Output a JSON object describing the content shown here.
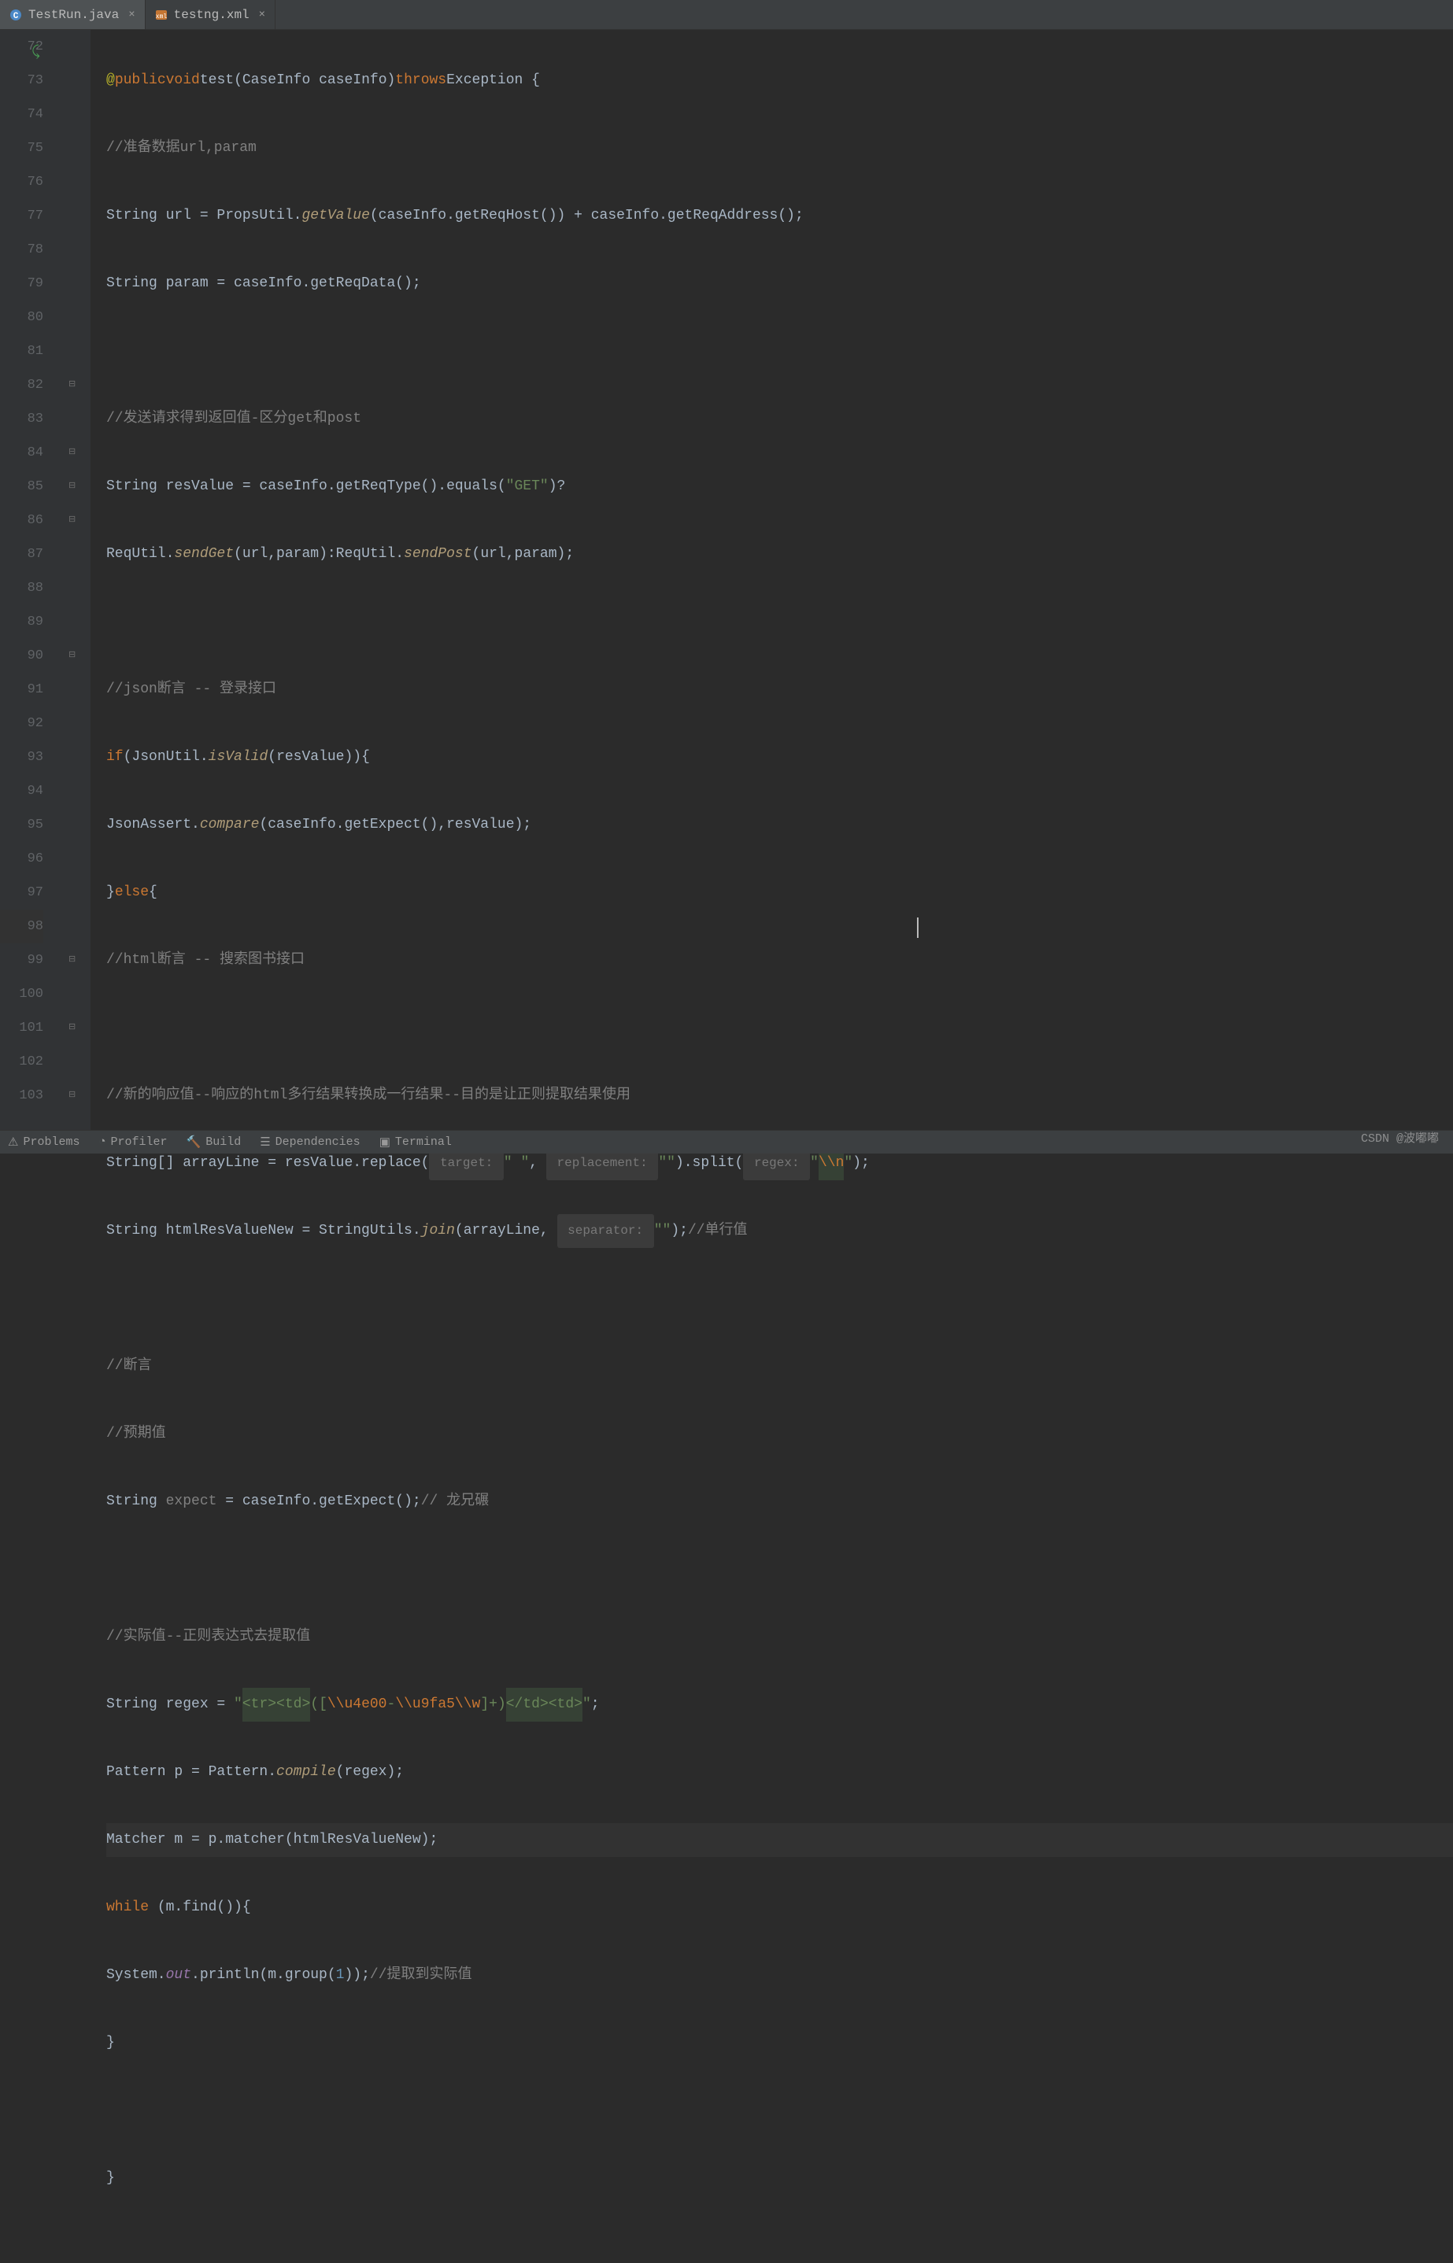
{
  "tabs": [
    {
      "label": "TestRun.java",
      "icon": "java-class-icon",
      "active": true
    },
    {
      "label": "testng.xml",
      "icon": "xml-icon",
      "active": false
    }
  ],
  "gutter": {
    "start": 72,
    "end": 103,
    "highlighted": 98
  },
  "code": {
    "l72_annotation": "@",
    "l72": {
      "kw1": "public",
      "kw2": "void",
      "name": "test",
      "p1": "(CaseInfo caseInfo)",
      "kw3": "throws",
      "ex": "Exception {"
    },
    "l73": "//准备数据url,param",
    "l74": {
      "t": "String url = PropsUtil.",
      "m": "getValue",
      "r": "(caseInfo.getReqHost()) + caseInfo.getReqAddress();"
    },
    "l75": "String param = caseInfo.getReqData();",
    "l77": "//发送请求得到返回值-区分get和post",
    "l78": {
      "a": "String resValue = caseInfo.getReqType().equals(",
      "s": "\"GET\"",
      "b": ")?"
    },
    "l79": {
      "a": "ReqUtil.",
      "m1": "sendGet",
      "b": "(url,param):ReqUtil.",
      "m2": "sendPost",
      "c": "(url,param);"
    },
    "l81": "//json断言 -- 登录接口",
    "l82": {
      "kw": "if",
      "a": "(JsonUtil.",
      "m": "isValid",
      "b": "(resValue)){"
    },
    "l83": {
      "a": "JsonAssert.",
      "m": "compare",
      "b": "(caseInfo.getExpect(),resValue);"
    },
    "l84": {
      "a": "}",
      "kw": "else",
      "b": "{"
    },
    "l85": "//html断言 -- 搜索图书接口",
    "l87": "//新的响应值--响应的html多行结果转换成一行结果--目的是让正则提取结果使用",
    "l88": {
      "a": "String[] arrayLine = resValue.replace(",
      "h1": " target: ",
      "s1": "\" \"",
      "c": ", ",
      "h2": " replacement: ",
      "s2": "\"\"",
      "d": ").split(",
      "h3": " regex: ",
      "s3a": "\"",
      "esc": "\\\\n",
      "s3b": "\"",
      "e": ");"
    },
    "l89": {
      "a": "String htmlResValueNew = StringUtils.",
      "m": "join",
      "b": "(arrayLine, ",
      "h": " separator: ",
      "s": "\"\"",
      "c": ");",
      "cm": "//单行值"
    },
    "l91": "//断言",
    "l92": "//预期值",
    "l93": {
      "a": "String ",
      "v": "expect",
      "b": " = caseInfo.getExpect();",
      "cm": "// 龙兄碾"
    },
    "l95": "//实际值--正则表达式去提取值",
    "l96": {
      "a": "String regex = ",
      "q1": "\"",
      "tag1": "<tr><td>",
      "mid": "([",
      "esc1": "\\\\u4e00",
      "dash": "-",
      "esc2": "\\\\u9fa5\\\\w",
      "mid2": "]+)",
      "tag2": "</td><td>",
      "q2": "\"",
      "end": ";"
    },
    "l97": {
      "a": "Pattern p = Pattern.",
      "m": "compile",
      "b": "(regex);"
    },
    "l98": "Matcher m = p.matcher(htmlResValueNew);",
    "l99": {
      "kw": "while",
      "a": " (m.find()){"
    },
    "l100": {
      "a": "System.",
      "f": "out",
      "b": ".println(m.group(",
      "n": "1",
      "c": "));",
      "cm": "//提取到实际值"
    },
    "l101": "}",
    "l103": "}"
  },
  "bottom": {
    "problems": "Problems",
    "profiler": "Profiler",
    "build": "Build",
    "dependencies": "Dependencies",
    "terminal": "Terminal"
  },
  "watermark": "CSDN @波嘟嘟"
}
